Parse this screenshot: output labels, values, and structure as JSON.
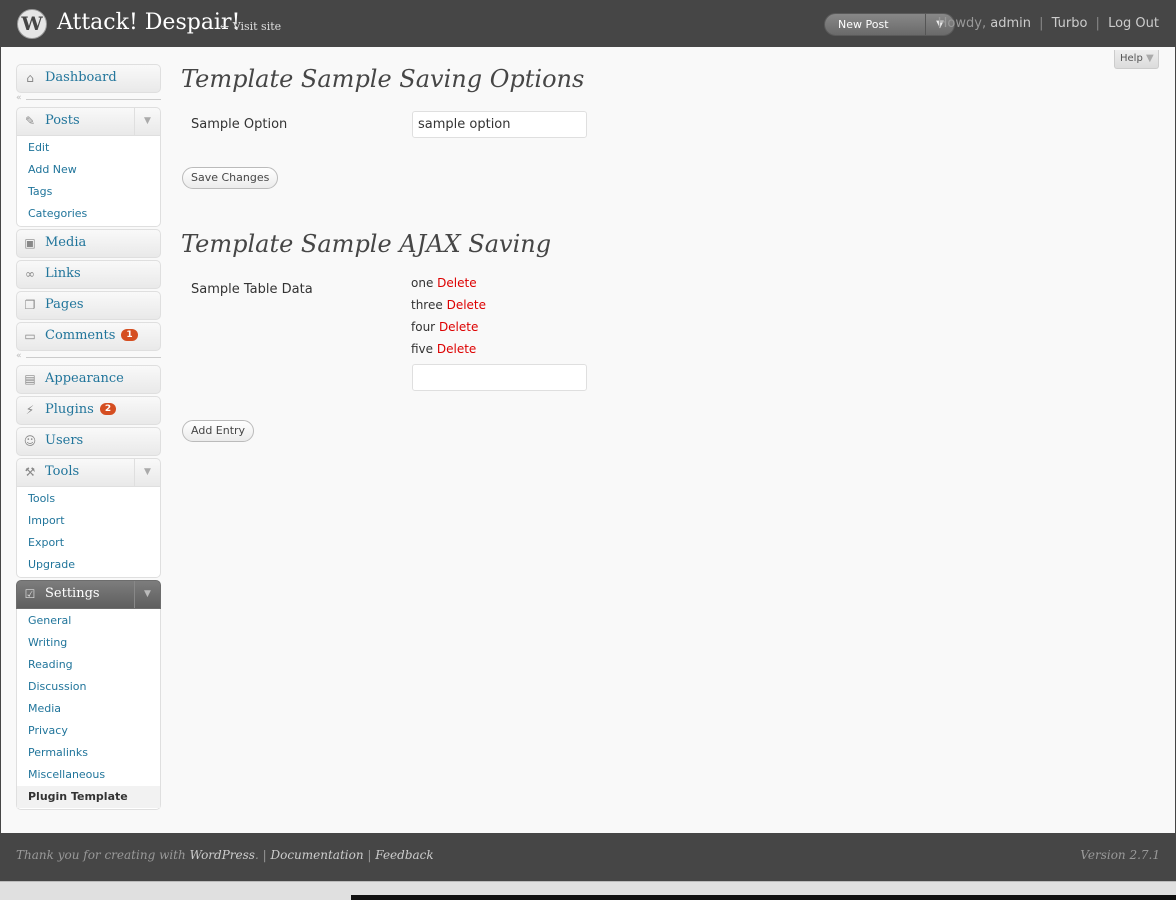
{
  "header": {
    "logo_glyph": "W",
    "site_title": "Attack! Despair!",
    "visit_site": "← Visit site",
    "favorite_action": "New Post",
    "howdy": "Howdy,",
    "user": "admin",
    "turbo": "Turbo",
    "separator": "|",
    "logout": "Log Out"
  },
  "help": "Help",
  "menu": {
    "dashboard": "Dashboard",
    "posts": {
      "label": "Posts",
      "items": [
        "Edit",
        "Add New",
        "Tags",
        "Categories"
      ]
    },
    "media": "Media",
    "links": "Links",
    "pages": "Pages",
    "comments": {
      "label": "Comments",
      "count": "1"
    },
    "appearance": "Appearance",
    "plugins": {
      "label": "Plugins",
      "count": "2"
    },
    "users": "Users",
    "tools": {
      "label": "Tools",
      "items": [
        "Tools",
        "Import",
        "Export",
        "Upgrade"
      ]
    },
    "settings": {
      "label": "Settings",
      "items": [
        "General",
        "Writing",
        "Reading",
        "Discussion",
        "Media",
        "Privacy",
        "Permalinks",
        "Miscellaneous",
        "Plugin Template"
      ]
    }
  },
  "section1": {
    "title": "Template Sample Saving Options",
    "option_label": "Sample Option",
    "option_value": "sample option",
    "save_button": "Save Changes"
  },
  "section2": {
    "title": "Template Sample AJAX Saving",
    "table_label": "Sample Table Data",
    "rows": [
      "one",
      "three",
      "four",
      "five"
    ],
    "delete_label": "Delete",
    "entry_value": "",
    "add_button": "Add Entry"
  },
  "footer": {
    "thanks": "Thank you for creating with",
    "wordpress": "WordPress",
    "period": ".",
    "documentation": "Documentation",
    "feedback": "Feedback",
    "version": "Version 2.7.1"
  },
  "colors": {
    "header_bg": "#464646",
    "link": "#21759b",
    "delete": "#dd0000",
    "badge": "#d54e21"
  }
}
